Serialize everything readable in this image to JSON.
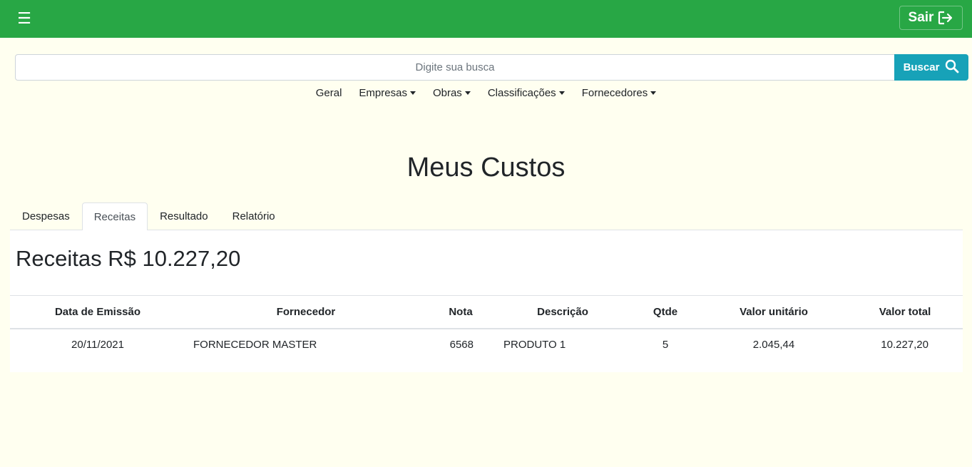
{
  "header": {
    "menu_icon": "hamburger-icon",
    "logout_label": "Sair",
    "logout_icon": "sign-out-icon",
    "brand_color": "#28a745"
  },
  "search": {
    "placeholder": "Digite sua busca",
    "value": "",
    "button_label": "Buscar",
    "button_icon": "search-icon",
    "button_color": "#17a2b8"
  },
  "nav": {
    "items": [
      {
        "label": "Geral",
        "dropdown": false
      },
      {
        "label": "Empresas",
        "dropdown": true
      },
      {
        "label": "Obras",
        "dropdown": true
      },
      {
        "label": "Classificações",
        "dropdown": true
      },
      {
        "label": "Fornecedores",
        "dropdown": true
      }
    ]
  },
  "page": {
    "title": "Meus Custos"
  },
  "tabs": [
    {
      "label": "Despesas",
      "active": false
    },
    {
      "label": "Receitas",
      "active": true
    },
    {
      "label": "Resultado",
      "active": false
    },
    {
      "label": "Relatório",
      "active": false
    }
  ],
  "receitas": {
    "heading": "Receitas R$ 10.227,20",
    "columns": [
      "Data de Emissão",
      "Fornecedor",
      "Nota",
      "Descrição",
      "Qtde",
      "Valor unitário",
      "Valor total"
    ],
    "rows": [
      [
        "20/11/2021",
        "FORNECEDOR MASTER",
        "6568",
        "PRODUTO 1",
        "5",
        "2.045,44",
        "10.227,20"
      ]
    ]
  }
}
